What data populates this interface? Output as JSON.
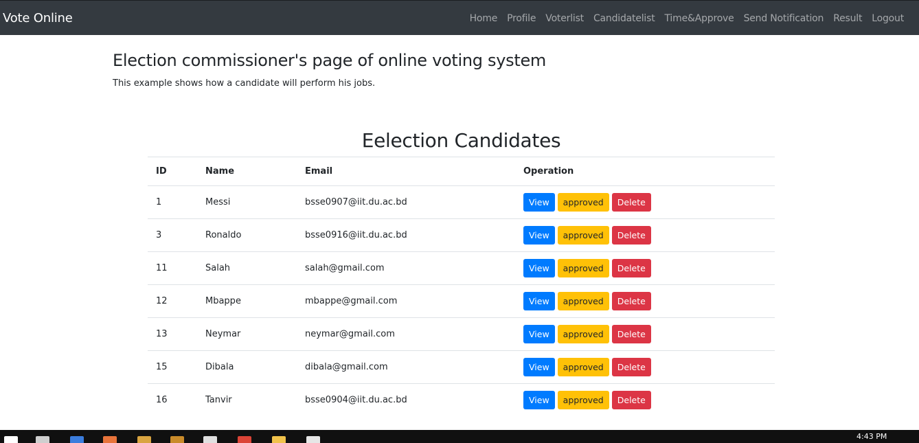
{
  "navbar": {
    "brand": "Vote Online",
    "links": [
      "Home",
      "Profile",
      "Voterlist",
      "Candidatelist",
      "Time&Approve",
      "Send Notification",
      "Result",
      "Logout"
    ]
  },
  "header": {
    "title": "Election commissioner's page of online voting system",
    "subtitle": "This example shows how a candidate will perform his jobs."
  },
  "table": {
    "title": "Eelection Candidates",
    "columns": [
      "ID",
      "Name",
      "Email",
      "Operation"
    ],
    "button_labels": {
      "view": "View",
      "approved": "approved",
      "delete": "Delete"
    },
    "rows": [
      {
        "id": "1",
        "name": "Messi",
        "email": "bsse0907@iit.du.ac.bd"
      },
      {
        "id": "3",
        "name": "Ronaldo",
        "email": "bsse0916@iit.du.ac.bd"
      },
      {
        "id": "11",
        "name": "Salah",
        "email": "salah@gmail.com"
      },
      {
        "id": "12",
        "name": "Mbappe",
        "email": "mbappe@gmail.com"
      },
      {
        "id": "13",
        "name": "Neymar",
        "email": "neymar@gmail.com"
      },
      {
        "id": "15",
        "name": "Dibala",
        "email": "dibala@gmail.com"
      },
      {
        "id": "16",
        "name": "Tanvir",
        "email": "bsse0904@iit.du.ac.bd"
      }
    ]
  },
  "taskbar": {
    "clock": "4:43 PM",
    "icons": [
      "start-icon",
      "task-view-icon",
      "app-icon",
      "app-icon",
      "app-icon",
      "app-icon",
      "file-icon",
      "chrome-icon",
      "folder-icon",
      "app-icon"
    ]
  },
  "colors": {
    "navbar_bg": "#343a40",
    "primary": "#007bff",
    "warning": "#ffc107",
    "danger": "#dc3545"
  }
}
